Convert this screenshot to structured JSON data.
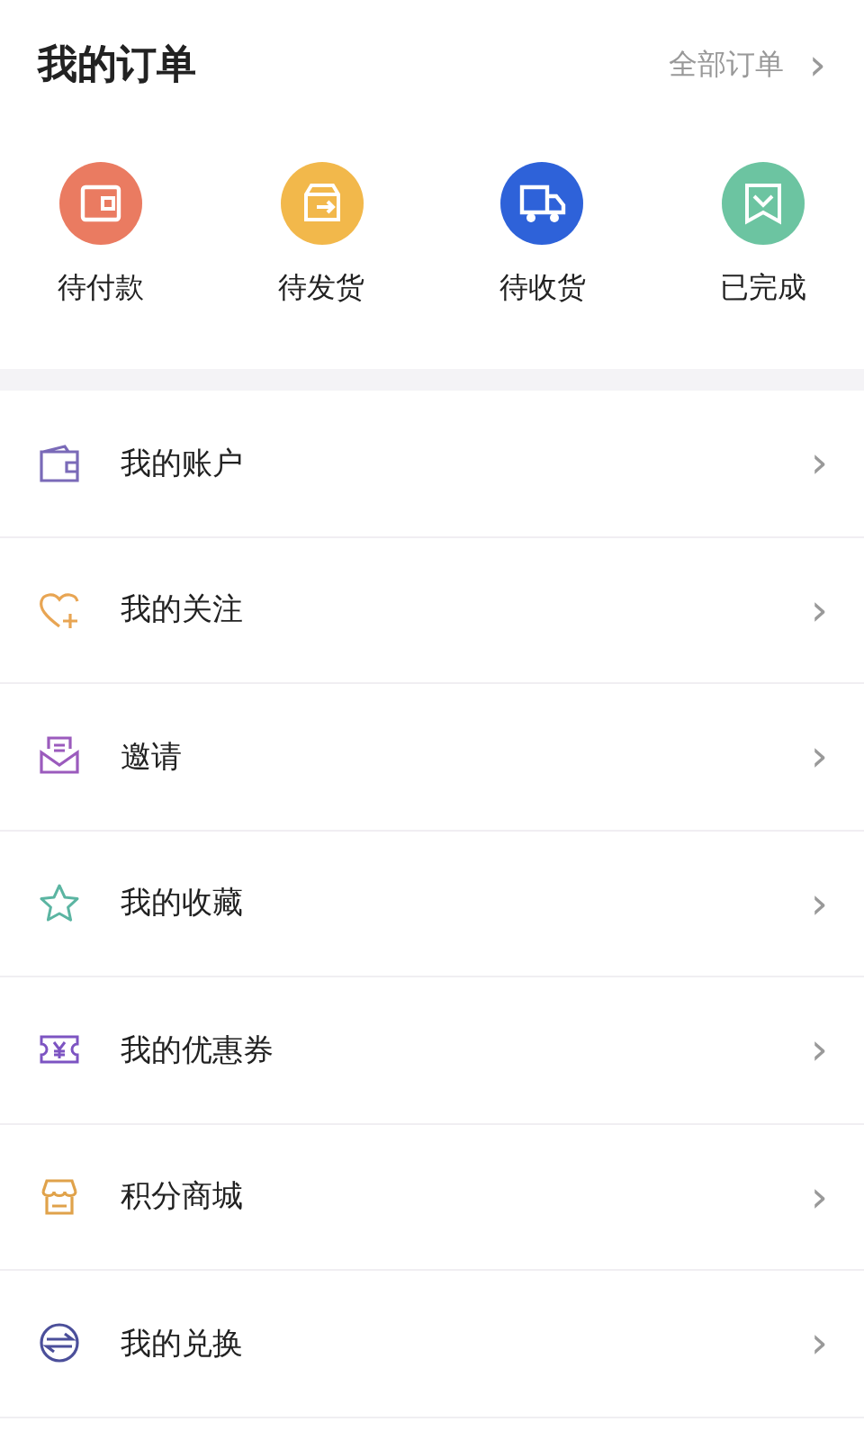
{
  "header": {
    "title": "我的订单",
    "link": "全部订单",
    "link_arrow": "›"
  },
  "order_statuses": [
    {
      "label": "待付款",
      "kind": "wallet",
      "color": "#ea7b61"
    },
    {
      "label": "待发货",
      "kind": "box",
      "color": "#f2b84b"
    },
    {
      "label": "待收货",
      "kind": "truck",
      "color": "#2e62d9"
    },
    {
      "label": "已完成",
      "kind": "receipt",
      "color": "#6cc4a1"
    }
  ],
  "menu": [
    {
      "label": "我的账户",
      "kind": "wallet",
      "color": "#7a6ab8",
      "arrow": "›"
    },
    {
      "label": "我的关注",
      "kind": "heart",
      "color": "#e8a553",
      "arrow": "›"
    },
    {
      "label": "邀请",
      "kind": "mail",
      "color": "#9b5bbd",
      "arrow": "›"
    },
    {
      "label": "我的收藏",
      "kind": "star",
      "color": "#5bb5a2",
      "arrow": "›"
    },
    {
      "label": "我的优惠券",
      "kind": "coupon",
      "color": "#7d54c2",
      "arrow": "›"
    },
    {
      "label": "积分商城",
      "kind": "shop",
      "color": "#e0a24a",
      "arrow": "›"
    },
    {
      "label": "我的兑换",
      "kind": "exchange",
      "color": "#4b4f9a",
      "arrow": "›"
    }
  ]
}
